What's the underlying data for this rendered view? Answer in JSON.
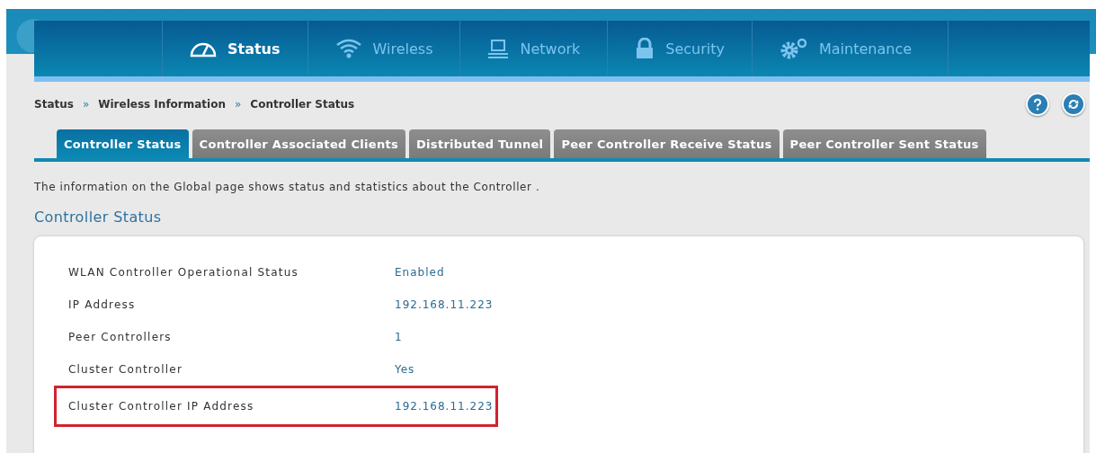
{
  "nav": {
    "items": [
      {
        "label": "Status",
        "selected": true
      },
      {
        "label": "Wireless",
        "selected": false
      },
      {
        "label": "Network",
        "selected": false
      },
      {
        "label": "Security",
        "selected": false
      },
      {
        "label": "Maintenance",
        "selected": false
      }
    ]
  },
  "breadcrumb": {
    "items": [
      "Status",
      "Wireless Information",
      "Controller Status"
    ],
    "separator": "»"
  },
  "tabs": [
    {
      "label": "Controller Status",
      "selected": true
    },
    {
      "label": "Controller Associated Clients",
      "selected": false
    },
    {
      "label": "Distributed Tunnel",
      "selected": false
    },
    {
      "label": "Peer Controller Receive Status",
      "selected": false
    },
    {
      "label": "Peer Controller Sent Status",
      "selected": false
    }
  ],
  "description": "The information on the Global page shows status and statistics about the Controller .",
  "section": {
    "title": "Controller Status",
    "rows": [
      {
        "label": "WLAN Controller Operational Status",
        "value": "Enabled",
        "highlighted": false
      },
      {
        "label": "IP Address",
        "value": "192.168.11.223",
        "highlighted": false
      },
      {
        "label": "Peer Controllers",
        "value": "1",
        "highlighted": false
      },
      {
        "label": "Cluster Controller",
        "value": "Yes",
        "highlighted": false
      },
      {
        "label": "Cluster Controller IP Address",
        "value": "192.168.11.223",
        "highlighted": true
      }
    ]
  }
}
